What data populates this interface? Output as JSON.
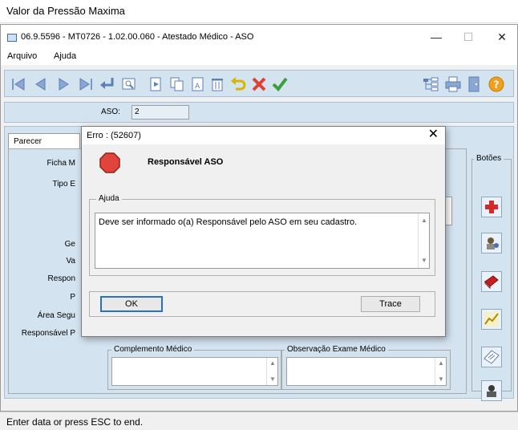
{
  "outer": {
    "title": "Valor da Pressão Maxima",
    "status": "Enter data or press ESC to end."
  },
  "window": {
    "title": "06.9.5596 - MT0726 - 1.02.00.060 - Atestado Médico - ASO",
    "minimize": "—",
    "maximize": "☐",
    "close": "✕"
  },
  "menu": {
    "items": [
      {
        "label": "Arquivo"
      },
      {
        "label": "Ajuda"
      }
    ]
  },
  "toolbar": {
    "icons": [
      "first-icon",
      "prev-icon",
      "next-icon",
      "last-icon",
      "enter-icon",
      "preview-icon",
      "add-page-icon",
      "copy-icon",
      "edit-icon",
      "delete-icon",
      "undo-icon",
      "cancel-icon",
      "confirm-icon",
      "tree-icon",
      "print-icon",
      "exit-door-icon",
      "help-icon"
    ]
  },
  "form": {
    "aso_label": "ASO:",
    "aso_value": "2",
    "tab_label": "Parecer",
    "labels": {
      "ficha": "Ficha M",
      "tipo": "Tipo E",
      "ge": "Ge",
      "va": "Va",
      "respon": "Respon",
      "p": "P",
      "area": "Área Segu",
      "resp_p": "Responsável P"
    },
    "complemento_label": "Complemento Médico",
    "observacao_label": "Observação Exame Médico",
    "buttons_group": "Botões"
  },
  "dialog": {
    "title": "Erro : (52607)",
    "close": "✕",
    "heading": "Responsável ASO",
    "help_label": "Ajuda",
    "message": "Deve ser informado o(a) Responsável pelo ASO em seu cadastro.",
    "ok": "OK",
    "trace": "Trace"
  },
  "colors": {
    "panel_bg": "#d4e3f0",
    "stop_red": "#e0443a",
    "ok_border": "#2b6fc9"
  }
}
